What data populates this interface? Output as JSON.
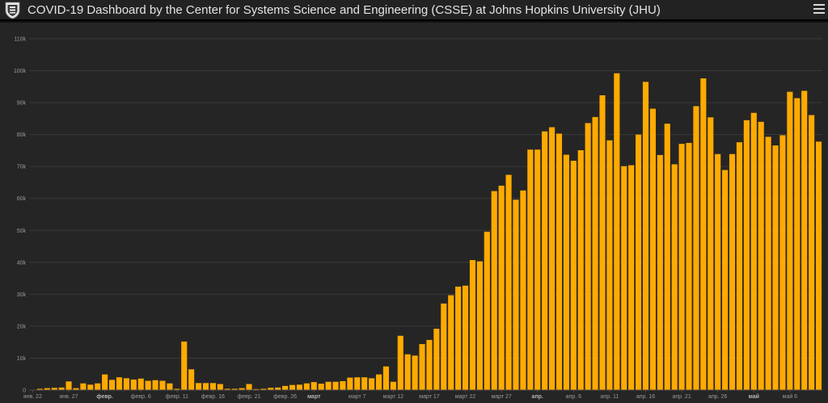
{
  "header": {
    "title": "COVID-19 Dashboard by the Center for Systems Science and Engineering (CSSE) at Johns Hopkins University (JHU)",
    "logo_icon": "university-shield-icon",
    "menu_icon": "hamburger-menu-icon"
  },
  "colors": {
    "bar": "#FFAA00",
    "background": "#252525",
    "header": "#222222",
    "grid": "#3a3a3a"
  },
  "chart_data": {
    "type": "bar",
    "title": "",
    "xlabel": "",
    "ylabel": "",
    "ylim": [
      0,
      110000
    ],
    "grid": true,
    "y_ticks": [
      {
        "value": 0,
        "label": "0"
      },
      {
        "value": 10000,
        "label": "10k"
      },
      {
        "value": 20000,
        "label": "20k"
      },
      {
        "value": 30000,
        "label": "30k"
      },
      {
        "value": 40000,
        "label": "40k"
      },
      {
        "value": 50000,
        "label": "50k"
      },
      {
        "value": 60000,
        "label": "60k"
      },
      {
        "value": 70000,
        "label": "70k"
      },
      {
        "value": 80000,
        "label": "80k"
      },
      {
        "value": 90000,
        "label": "90k"
      },
      {
        "value": 100000,
        "label": "100k"
      },
      {
        "value": 110000,
        "label": "110k"
      }
    ],
    "x_ticks": [
      {
        "index": 0,
        "label": "янв. 22",
        "major": false
      },
      {
        "index": 5,
        "label": "янв. 27",
        "major": false
      },
      {
        "index": 10,
        "label": "февр.",
        "major": true
      },
      {
        "index": 15,
        "label": "февр. 6",
        "major": false
      },
      {
        "index": 20,
        "label": "февр. 11",
        "major": false
      },
      {
        "index": 25,
        "label": "февр. 16",
        "major": false
      },
      {
        "index": 30,
        "label": "февр. 21",
        "major": false
      },
      {
        "index": 35,
        "label": "февр. 26",
        "major": false
      },
      {
        "index": 39,
        "label": "март",
        "major": true
      },
      {
        "index": 45,
        "label": "март 7",
        "major": false
      },
      {
        "index": 50,
        "label": "март 12",
        "major": false
      },
      {
        "index": 55,
        "label": "март 17",
        "major": false
      },
      {
        "index": 60,
        "label": "март 22",
        "major": false
      },
      {
        "index": 65,
        "label": "март 27",
        "major": false
      },
      {
        "index": 70,
        "label": "апр.",
        "major": true
      },
      {
        "index": 75,
        "label": "апр. 6",
        "major": false
      },
      {
        "index": 80,
        "label": "апр. 11",
        "major": false
      },
      {
        "index": 85,
        "label": "апр. 16",
        "major": false
      },
      {
        "index": 90,
        "label": "апр. 21",
        "major": false
      },
      {
        "index": 95,
        "label": "апр. 26",
        "major": false
      },
      {
        "index": 100,
        "label": "май",
        "major": true
      },
      {
        "index": 105,
        "label": "май 6",
        "major": false
      }
    ],
    "categories": [
      "янв. 22",
      "янв. 27",
      "февр.",
      "февр. 6",
      "февр. 11",
      "февр. 16",
      "февр. 21",
      "февр. 26",
      "март",
      "март 7",
      "март 12",
      "март 17",
      "март 22",
      "март 27",
      "апр.",
      "апр. 6",
      "апр. 11",
      "апр. 16",
      "апр. 21",
      "апр. 26",
      "май",
      "май 6"
    ],
    "values": [
      100,
      400,
      600,
      700,
      800,
      2700,
      600,
      2100,
      1700,
      2100,
      4900,
      3200,
      4000,
      3700,
      3300,
      3600,
      2900,
      3100,
      2900,
      2100,
      400,
      15200,
      6500,
      2200,
      2200,
      2200,
      1900,
      400,
      400,
      600,
      1900,
      300,
      400,
      700,
      800,
      1300,
      1600,
      1700,
      2100,
      2500,
      2000,
      2600,
      2600,
      2800,
      3900,
      4000,
      4000,
      3700,
      4900,
      7400,
      2600,
      17000,
      11200,
      10800,
      14400,
      15700,
      19200,
      27100,
      29700,
      32400,
      32700,
      40700,
      40300,
      49600,
      62300,
      64000,
      67400,
      59600,
      62500,
      75300,
      75300,
      81000,
      82300,
      80300,
      73700,
      71800,
      75100,
      83600,
      85500,
      92300,
      78200,
      99200,
      70100,
      70400,
      80000,
      96500,
      88100,
      73600,
      83400,
      70700,
      77100,
      77400,
      88900,
      97600,
      85400,
      73900,
      68900,
      73900,
      77600,
      84500,
      86800,
      84000,
      79300,
      76600,
      79800,
      93400,
      91400,
      93700,
      86100,
      77800
    ]
  }
}
